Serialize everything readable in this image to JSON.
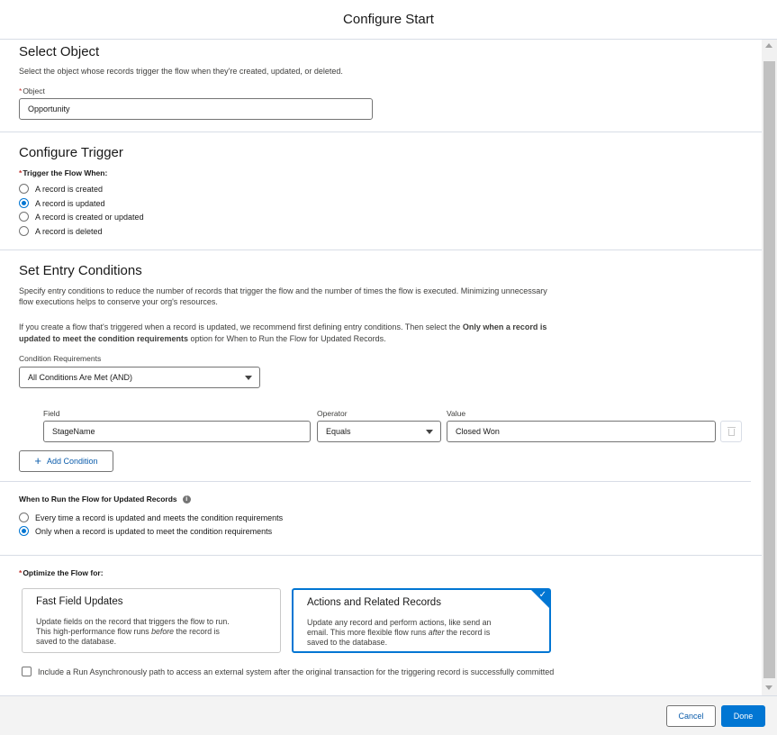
{
  "modal": {
    "title": "Configure Start"
  },
  "select_object": {
    "title": "Select Object",
    "description": "Select the object whose records trigger the flow when they're created, updated, or deleted.",
    "object_label": "Object",
    "object_value": "Opportunity"
  },
  "configure_trigger": {
    "title": "Configure Trigger",
    "label": "Trigger the Flow When:",
    "options": [
      {
        "label": "A record is created",
        "checked": false
      },
      {
        "label": "A record is updated",
        "checked": true
      },
      {
        "label": "A record is created or updated",
        "checked": false
      },
      {
        "label": "A record is deleted",
        "checked": false
      }
    ]
  },
  "entry_conditions": {
    "title": "Set Entry Conditions",
    "desc1_line1": "Specify entry conditions to reduce the number of records that trigger the flow and the number of times the flow is executed. Minimizing unnecessary",
    "desc1_line2": "flow executions helps to conserve your org's resources.",
    "desc2_line1_pre": "If you create a flow that's triggered when a record is updated, we recommend first defining entry conditions. Then select the ",
    "desc2_line1_bold": "Only when a record is",
    "desc2_line2_bold": "updated to meet the condition requirements",
    "desc2_line2_post": " option for When to Run the Flow for Updated Records.",
    "requirements_label": "Condition Requirements",
    "requirements_value": "All Conditions Are Met (AND)",
    "field_label": "Field",
    "operator_label": "Operator",
    "value_label": "Value",
    "condition": {
      "field": "StageName",
      "operator": "Equals",
      "value": "Closed Won"
    },
    "add_condition_label": "Add Condition"
  },
  "when_to_run": {
    "label": "When to Run the Flow for Updated Records",
    "info_glyph": "i",
    "options": [
      {
        "label": "Every time a record is updated and meets the condition requirements",
        "checked": false
      },
      {
        "label": "Only when a record is updated to meet the condition requirements",
        "checked": true
      }
    ]
  },
  "optimize": {
    "label": "Optimize the Flow for:",
    "fast": {
      "title": "Fast Field Updates",
      "line1": "Update fields on the record that triggers the flow to run.",
      "line2_pre": "This high-performance flow runs ",
      "line2_em": "before",
      "line2_post": " the record is",
      "line3": "saved to the database."
    },
    "actions": {
      "title": "Actions and Related Records",
      "line1": "Update any record and perform actions, like send an",
      "line2_pre": "email. This more flexible flow runs ",
      "line2_em": "after",
      "line2_post": " the record is",
      "line3": "saved to the database.",
      "selected": true
    },
    "async_label": "Include a Run Asynchronously path to access an external system after the original transaction for the triggering record is successfully committed"
  },
  "footer": {
    "cancel_label": "Cancel",
    "done_label": "Done"
  },
  "colors": {
    "brand": "#0176d3",
    "link": "#0b5cab",
    "required": "#c23934"
  }
}
